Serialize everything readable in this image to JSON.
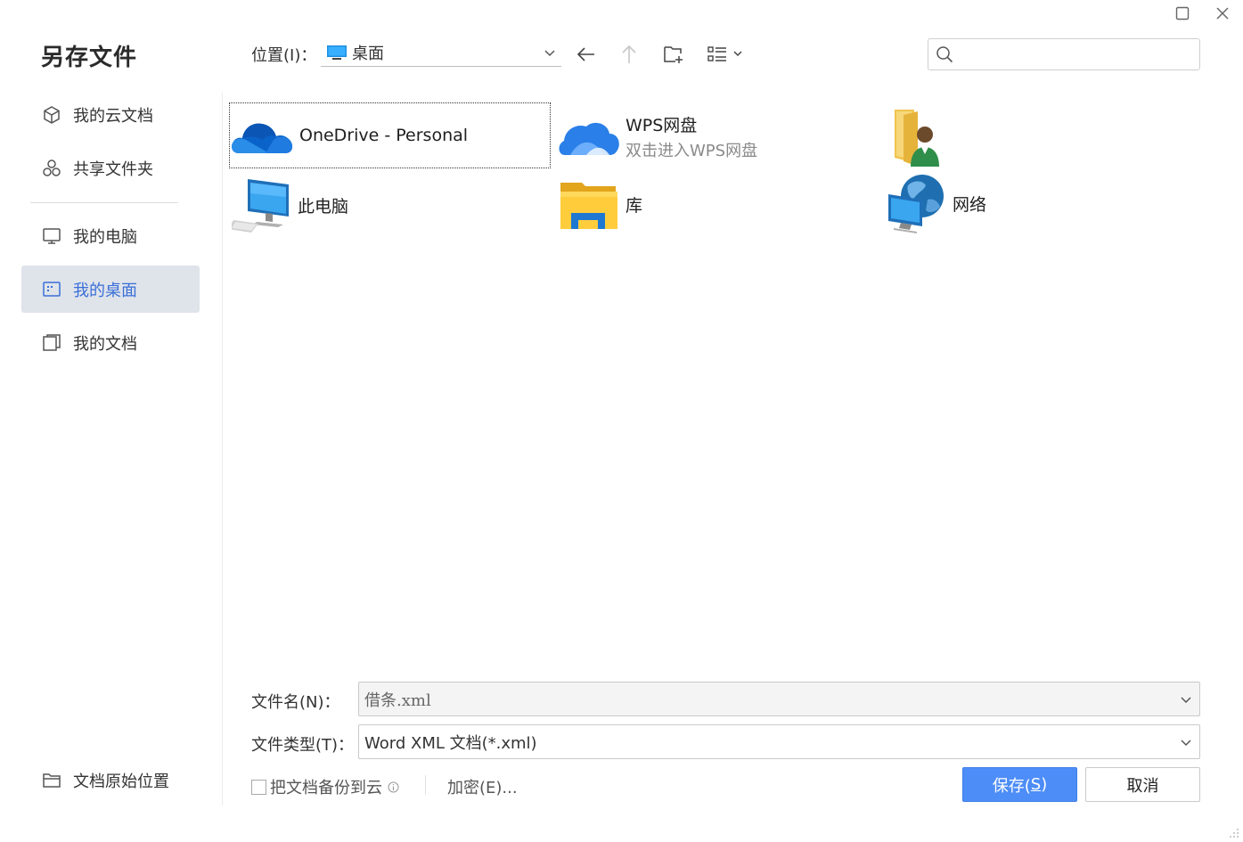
{
  "dialog": {
    "title": "另存文件"
  },
  "window_controls": {
    "maximize_icon": "maximize-icon",
    "close_icon": "close-icon"
  },
  "sidebar": {
    "items": [
      {
        "label": "我的云文档",
        "icon": "cube-icon"
      },
      {
        "label": "共享文件夹",
        "icon": "share-circles-icon"
      },
      {
        "label": "我的电脑",
        "icon": "monitor-icon"
      },
      {
        "label": "我的桌面",
        "icon": "desktop-icon",
        "active": true
      },
      {
        "label": "我的文档",
        "icon": "documents-icon"
      }
    ],
    "bottom_item": {
      "label": "文档原始位置",
      "icon": "folder-icon"
    }
  },
  "toolbar": {
    "location_label": "位置(I)：",
    "location_value": "桌面",
    "search_placeholder": ""
  },
  "content": {
    "items": [
      {
        "name": "OneDrive - Personal",
        "icon": "onedrive-cloud-icon",
        "selected": true
      },
      {
        "name": "WPS网盘",
        "subtitle": "双击进入WPS网盘",
        "icon": "wps-cloud-icon"
      },
      {
        "name": "",
        "icon": "user-folder-icon"
      },
      {
        "name": "此电脑",
        "icon": "computer-icon"
      },
      {
        "name": "库",
        "icon": "library-folder-icon"
      },
      {
        "name": "网络",
        "icon": "network-globe-icon"
      }
    ]
  },
  "form": {
    "filename_label": "文件名(N)：",
    "filename_value": "借条.xml",
    "filetype_label": "文件类型(T)：",
    "filetype_value": "Word XML 文档(*.xml)",
    "backup_label": "把文档备份到云",
    "encrypt_label": "加密(E)...",
    "save_label_main": "保存(",
    "save_label_key": "S",
    "save_label_end": ")",
    "cancel_label": "取消"
  },
  "colors": {
    "accent": "#4d8df7",
    "active_bg": "#dfe3ea",
    "active_text": "#3a6fd8"
  }
}
